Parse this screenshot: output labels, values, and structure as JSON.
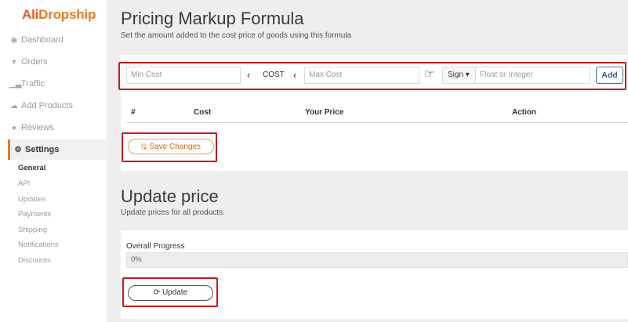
{
  "brand": {
    "part1": "Ali",
    "part2": "Dropship"
  },
  "sidebar": {
    "items": [
      {
        "label": "Dashboard",
        "icon": "dashboard-icon"
      },
      {
        "label": "Orders",
        "icon": "cart-icon"
      },
      {
        "label": "Traffic",
        "icon": "bar-chart-icon"
      },
      {
        "label": "Add Products",
        "icon": "cloud-icon"
      },
      {
        "label": "Reviews",
        "icon": "comment-icon"
      },
      {
        "label": "Settings",
        "icon": "gear-icon"
      }
    ],
    "submenu": [
      "General",
      "API",
      "Updates",
      "Payments",
      "Shipping",
      "Notifications",
      "Discounts"
    ]
  },
  "markup": {
    "title": "Pricing Markup Formula",
    "subtitle": "Set the amount added to the cost price of goods using this formula",
    "min_placeholder": "Min Cost",
    "cost_label": "COST",
    "lt_symbol": "‹",
    "max_placeholder": "Max Cost",
    "pointer_icon": "☞",
    "sign_label": "Sign ▾",
    "value_placeholder": "Float or Integer",
    "add_label": "Add",
    "columns": [
      "#",
      "Cost",
      "Your Price",
      "Action"
    ],
    "save_label": "Save Changes",
    "save_icon": "🖫"
  },
  "update": {
    "title": "Update price",
    "subtitle": "Update prices for all products.",
    "progress_label": "Overall Progress",
    "progress_value": "0%",
    "progress_fraction": 0,
    "button_label": "Update",
    "button_icon": "⟳"
  },
  "colors": {
    "accent": "#e57a1f",
    "highlight": "#c61a1a",
    "link": "#2a5b95"
  }
}
